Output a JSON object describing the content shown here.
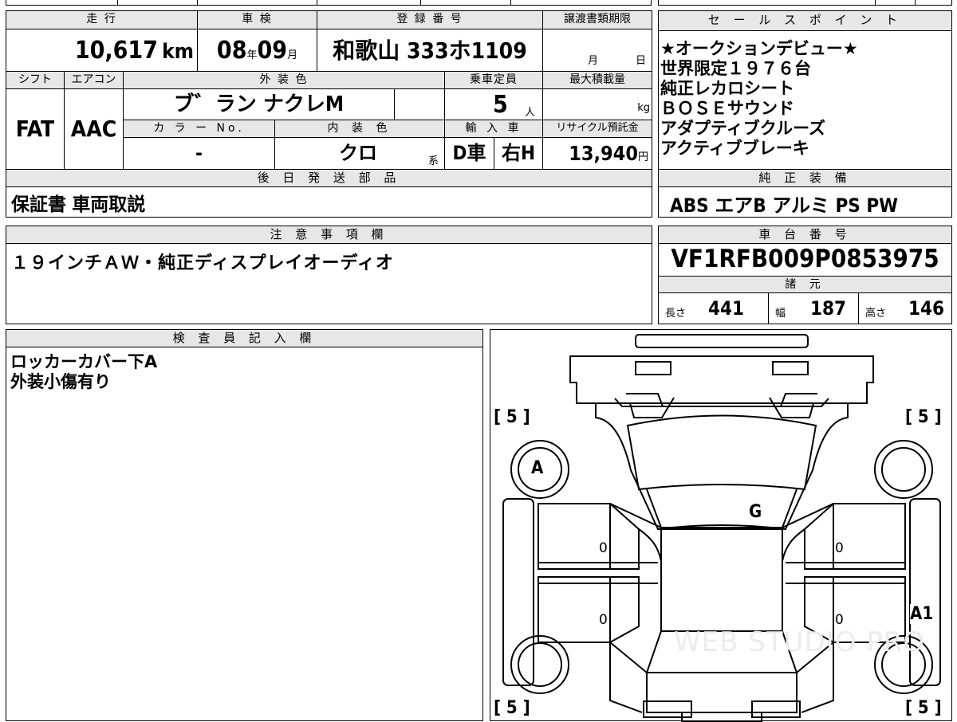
{
  "top_strip": "",
  "basic": {
    "headers": {
      "mileage": "走 行",
      "inspection": "車 検",
      "registration": "登 録 番 号",
      "transfer_deadline": "譲渡書類期限"
    },
    "mileage_value": "10,617",
    "mileage_unit": "km",
    "inspection_year": "08",
    "inspection_year_unit": "年",
    "inspection_month": "09",
    "inspection_month_unit": "月",
    "registration_number": "和歌山 333ホ1109",
    "transfer_month_unit": "月",
    "transfer_day_unit": "日"
  },
  "spec": {
    "headers": {
      "shift": "シフト",
      "aircon": "エアコン",
      "exterior_color": "外 装 色",
      "capacity": "乗車定員",
      "max_load": "最大積載量",
      "color_no": "カ ラ ー No.",
      "interior_color": "内 装 色",
      "import": "輸 入 車",
      "recycle": "リサイクル預託金"
    },
    "shift": "FAT",
    "aircon": "AAC",
    "exterior_color": "ブ゛ラン ナクレM",
    "capacity": "5",
    "capacity_unit": "人",
    "max_load_unit": "kg",
    "color_no": "-",
    "interior_color": "クロ",
    "interior_suffix": "系",
    "import_type": "D車",
    "steering": "右H",
    "recycle_fee": "13,940",
    "recycle_unit": "円"
  },
  "delivery": {
    "header": "後 日 発 送 部 品",
    "text": "保証書 車両取説"
  },
  "sales_points": {
    "header": "セ ー ル ス ポ イ ン ト",
    "lines": [
      "★オークションデビュー★",
      "世界限定１９７６台",
      "純正レカロシート",
      "ＢＯＳＥサウンド",
      "アダプティブクルーズ",
      "アクティブブレーキ"
    ]
  },
  "equipment": {
    "header": "純 正 装 備",
    "text": "ABS エアB アルミ PS PW"
  },
  "notes": {
    "header": "注 意 事 項 欄",
    "text": "１９インチＡＷ・純正ディスプレイオーディオ"
  },
  "chassis": {
    "header": "車 台 番 号",
    "number": "VF1RFB009P0853975"
  },
  "dimensions": {
    "header": "諸 元",
    "length_label": "長さ",
    "length": "441",
    "width_label": "幅",
    "width": "187",
    "height_label": "高さ",
    "height": "146"
  },
  "inspector": {
    "header": "検 査 員 記 入 欄",
    "lines": [
      "ロッカーカバー下A",
      "外装小傷有り"
    ]
  },
  "diagram": {
    "tire_depth_fl": "[ 5 ]",
    "tire_depth_fr": "[ 5 ]",
    "tire_depth_rl": "[ 5 ]",
    "tire_depth_rr": "[ 5 ]",
    "mark_fl_wheel": "A",
    "mark_windshield": "G",
    "mark_right_rocker": "A1",
    "door_left_front": "0",
    "door_left_rear": "0",
    "door_right_front": "0",
    "door_right_rear": "0",
    "watermark": "WEB STUDIO PRO"
  }
}
